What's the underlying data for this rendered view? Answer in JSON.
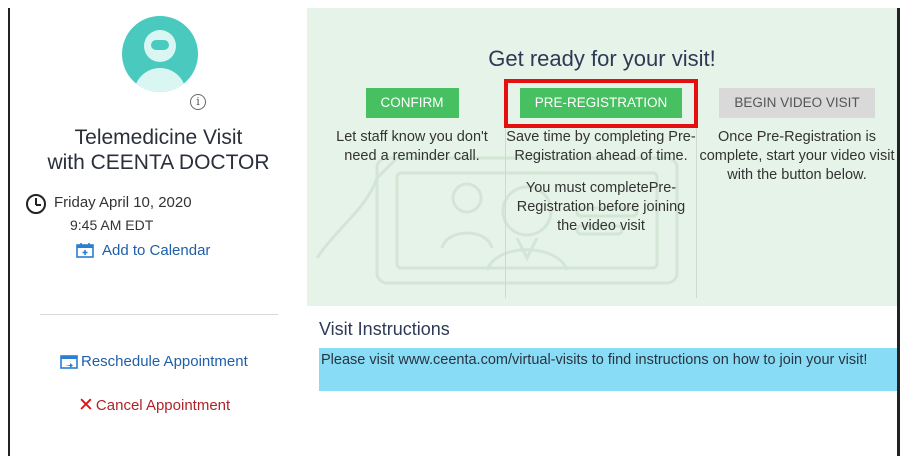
{
  "left": {
    "visit_title_line1": "Telemedicine Visit",
    "visit_title_line2": "with CEENTA DOCTOR",
    "date": "Friday April 10, 2020",
    "time": "9:45 AM EDT",
    "add_to_calendar": "Add to Calendar",
    "reschedule": "Reschedule Appointment",
    "cancel": "Cancel Appointment",
    "info_glyph": "i"
  },
  "ready": {
    "title": "Get ready for your visit!",
    "confirm": {
      "button": "CONFIRM",
      "desc": "Let staff know you don't need a reminder call."
    },
    "prereg": {
      "button": "PRE-REGISTRATION",
      "desc": "Save time by completing Pre-Registration ahead of time.",
      "note": "You must completePre-Registration before joining the video visit"
    },
    "video": {
      "button": "BEGIN VIDEO VISIT",
      "desc": "Once Pre-Registration is complete, start your video visit with the button below."
    }
  },
  "instructions": {
    "title": "Visit Instructions",
    "text": "Please visit www.ceenta.com/virtual-visits to find instructions on how to join your visit!"
  },
  "icons": [
    "avatar",
    "info-icon",
    "clock-icon",
    "calendar-add-icon",
    "reschedule-icon",
    "close-icon"
  ],
  "colors": {
    "accent_green": "#46c060",
    "panel_bg": "#e6f3e8",
    "highlight_red": "#e41010",
    "instructions_bg": "#89dcf5",
    "link_blue": "#1f5fa8",
    "cancel_red": "#b0232a"
  }
}
